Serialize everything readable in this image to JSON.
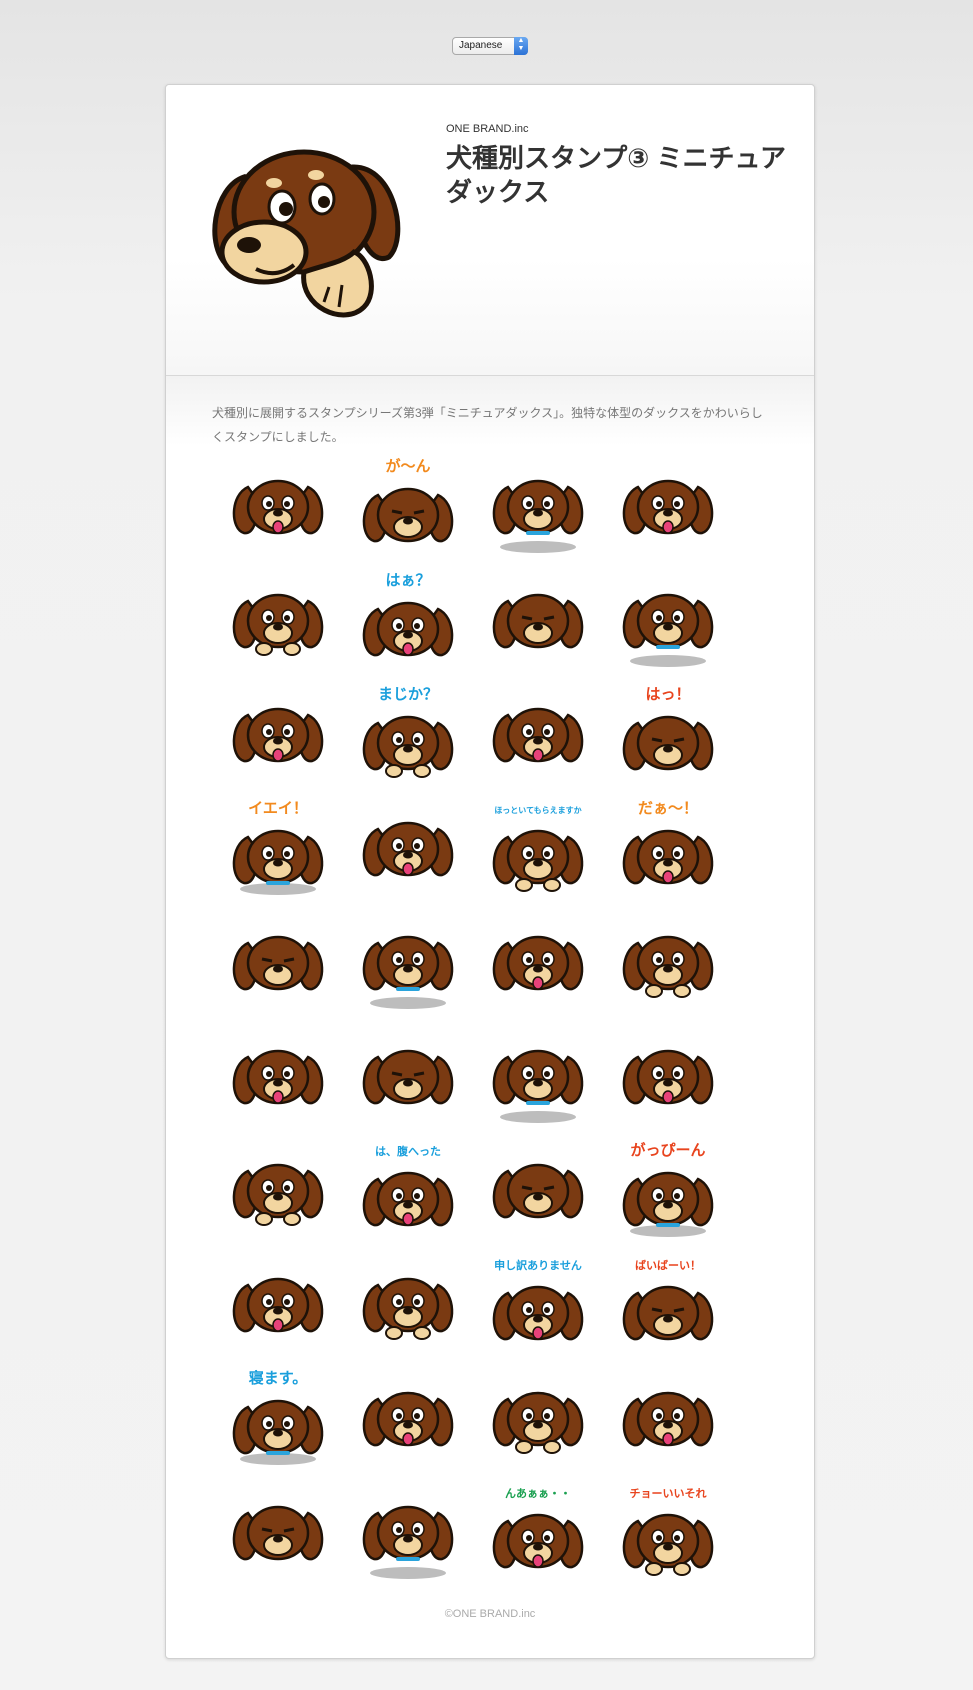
{
  "language_selector": {
    "value": "Japanese"
  },
  "app": {
    "brand": "ONE BRAND.inc",
    "title": "犬種別スタンプ③ ミニチュアダックス",
    "description": "犬種別に展開するスタンプシリーズ第3弾「ミニチュアダックス」。独特な体型のダックスをかわいらしくスタンプにしました。",
    "copyright": "©ONE BRAND.inc"
  },
  "colors": {
    "fur": "#7a3a12",
    "tan": "#f2d5a0",
    "outline": "#1e1208",
    "tongue": "#e8427a",
    "collar_blue": "#2aa4dc"
  },
  "stickers": [
    {
      "caption": "",
      "caption_color": "#f28a1e"
    },
    {
      "caption": "が～ん",
      "caption_color": "#f28a1e"
    },
    {
      "caption": "",
      "caption_color": "#f28a1e"
    },
    {
      "caption": "",
      "caption_color": "#f28a1e"
    },
    {
      "caption": "",
      "caption_color": "#f28a1e"
    },
    {
      "caption": "はぁ？",
      "caption_color": "#1a9fdc"
    },
    {
      "caption": "",
      "caption_color": "#f28a1e"
    },
    {
      "caption": "",
      "caption_color": "#f28a1e"
    },
    {
      "caption": "",
      "caption_color": "#f28a1e"
    },
    {
      "caption": "まじか？",
      "caption_color": "#1a9fdc"
    },
    {
      "caption": "",
      "caption_color": "#f28a1e"
    },
    {
      "caption": "はっ！",
      "caption_color": "#e8441e"
    },
    {
      "caption": "イエイ！",
      "caption_color": "#f28a1e"
    },
    {
      "caption": "",
      "caption_color": "#f28a1e"
    },
    {
      "caption": "ほっといてもらえますか",
      "caption_color": "#1a9fdc"
    },
    {
      "caption": "だぁ～！",
      "caption_color": "#f28a1e"
    },
    {
      "caption": "",
      "caption_color": "#f28a1e"
    },
    {
      "caption": "",
      "caption_color": "#f28a1e"
    },
    {
      "caption": "",
      "caption_color": "#f28a1e"
    },
    {
      "caption": "",
      "caption_color": "#f28a1e"
    },
    {
      "caption": "",
      "caption_color": "#f28a1e"
    },
    {
      "caption": "",
      "caption_color": "#f28a1e"
    },
    {
      "caption": "",
      "caption_color": "#f28a1e"
    },
    {
      "caption": "",
      "caption_color": "#f28a1e"
    },
    {
      "caption": "",
      "caption_color": "#f28a1e"
    },
    {
      "caption": "は、腹へった",
      "caption_color": "#1a9fdc"
    },
    {
      "caption": "",
      "caption_color": "#f28a1e"
    },
    {
      "caption": "がっぴーん",
      "caption_color": "#e8441e"
    },
    {
      "caption": "",
      "caption_color": "#f28a1e"
    },
    {
      "caption": "",
      "caption_color": "#f28a1e"
    },
    {
      "caption": "申し訳ありません",
      "caption_color": "#1a9fdc"
    },
    {
      "caption": "ばいばーい！",
      "caption_color": "#e8441e"
    },
    {
      "caption": "寝ます。",
      "caption_color": "#1a9fdc"
    },
    {
      "caption": "",
      "caption_color": "#f28a1e"
    },
    {
      "caption": "",
      "caption_color": "#f28a1e"
    },
    {
      "caption": "",
      "caption_color": "#f28a1e"
    },
    {
      "caption": "",
      "caption_color": "#f28a1e"
    },
    {
      "caption": "",
      "caption_color": "#f28a1e"
    },
    {
      "caption": "んあぁぁ・・",
      "caption_color": "#1aa050"
    },
    {
      "caption": "チョーいいそれ",
      "caption_color": "#e8441e"
    }
  ]
}
